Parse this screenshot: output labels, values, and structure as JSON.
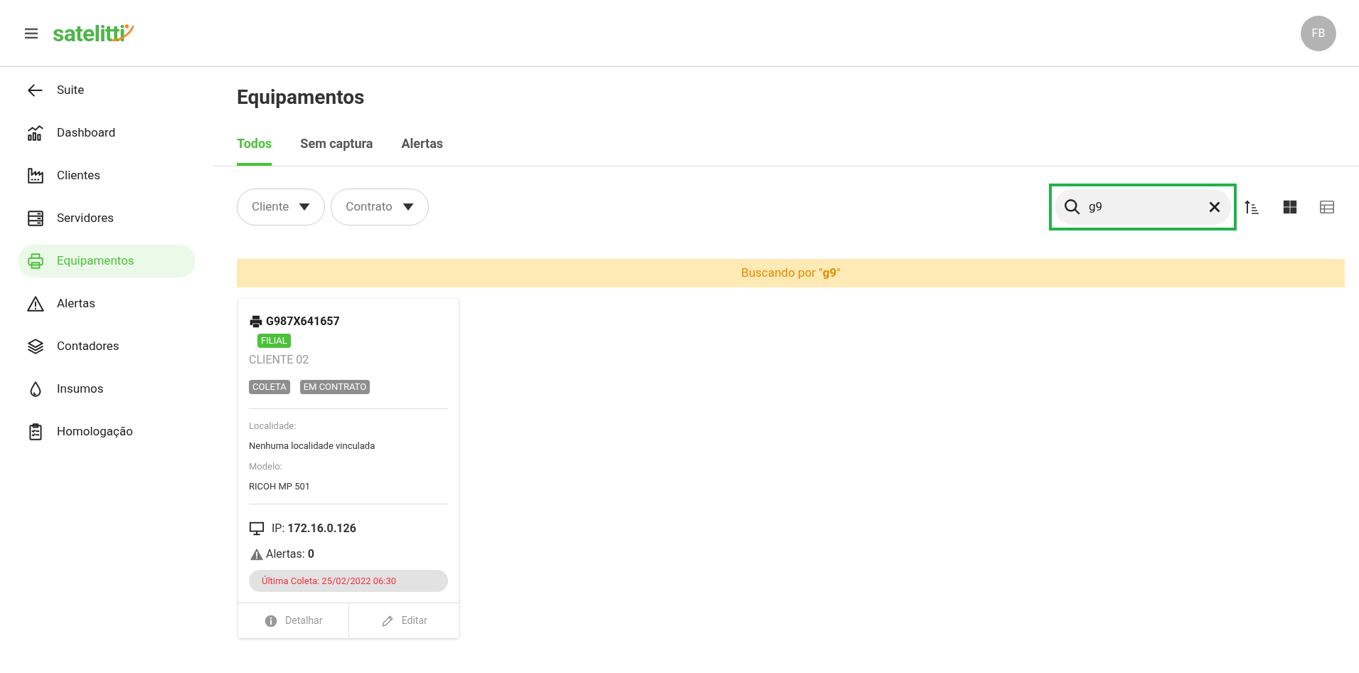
{
  "header": {
    "logo": "satelitti",
    "avatar": "FB"
  },
  "sidebar": {
    "items": [
      {
        "label": "Suite",
        "kind": "back",
        "selected": false
      },
      {
        "label": "Dashboard",
        "kind": "chart",
        "selected": false
      },
      {
        "label": "Clientes",
        "kind": "factory",
        "selected": false
      },
      {
        "label": "Servidores",
        "kind": "server",
        "selected": false
      },
      {
        "label": "Equipamentos",
        "kind": "printer",
        "selected": true
      },
      {
        "label": "Alertas",
        "kind": "alert",
        "selected": false
      },
      {
        "label": "Contadores",
        "kind": "layers",
        "selected": false
      },
      {
        "label": "Insumos",
        "kind": "drop",
        "selected": false
      },
      {
        "label": "Homologação",
        "kind": "clipboard",
        "selected": false
      }
    ]
  },
  "page": {
    "title": "Equipamentos",
    "tabs": [
      {
        "label": "Todos",
        "selected": true
      },
      {
        "label": "Sem captura",
        "selected": false
      },
      {
        "label": "Alertas",
        "selected": false
      }
    ],
    "filters": [
      {
        "label": "Cliente"
      },
      {
        "label": "Contrato"
      }
    ],
    "search": {
      "value": "g9",
      "highlighted": true
    },
    "views": [
      {
        "kind": "grid",
        "selected": true
      },
      {
        "kind": "table",
        "selected": false
      }
    ],
    "banner": "Buscando por \"**g9**\"",
    "cards": [
      {
        "serial": "G987X641657",
        "badge": {
          "label": "FILIAL",
          "color": "#4cc13a"
        },
        "client": "CLIENTE 02",
        "tags": [
          {
            "label": "COLETA",
            "color": "#8e8e8e"
          },
          {
            "label": "EM CONTRATO",
            "color": "#8e8e8e"
          }
        ],
        "fields": [
          {
            "label": "Localidade:",
            "value": "Nenhuma localidade vinculada"
          },
          {
            "label": "Modelo:",
            "value": "RICOH MP 501"
          }
        ],
        "ip": "IP: **172.16.0.126**",
        "alerts": "Alertas: **0**",
        "last_collect": "Última Coleta: 25/02/2022 06:30",
        "actions": [
          {
            "label": "Detalhar",
            "kind": "info"
          },
          {
            "label": "Editar",
            "kind": "pencil"
          }
        ]
      }
    ]
  }
}
